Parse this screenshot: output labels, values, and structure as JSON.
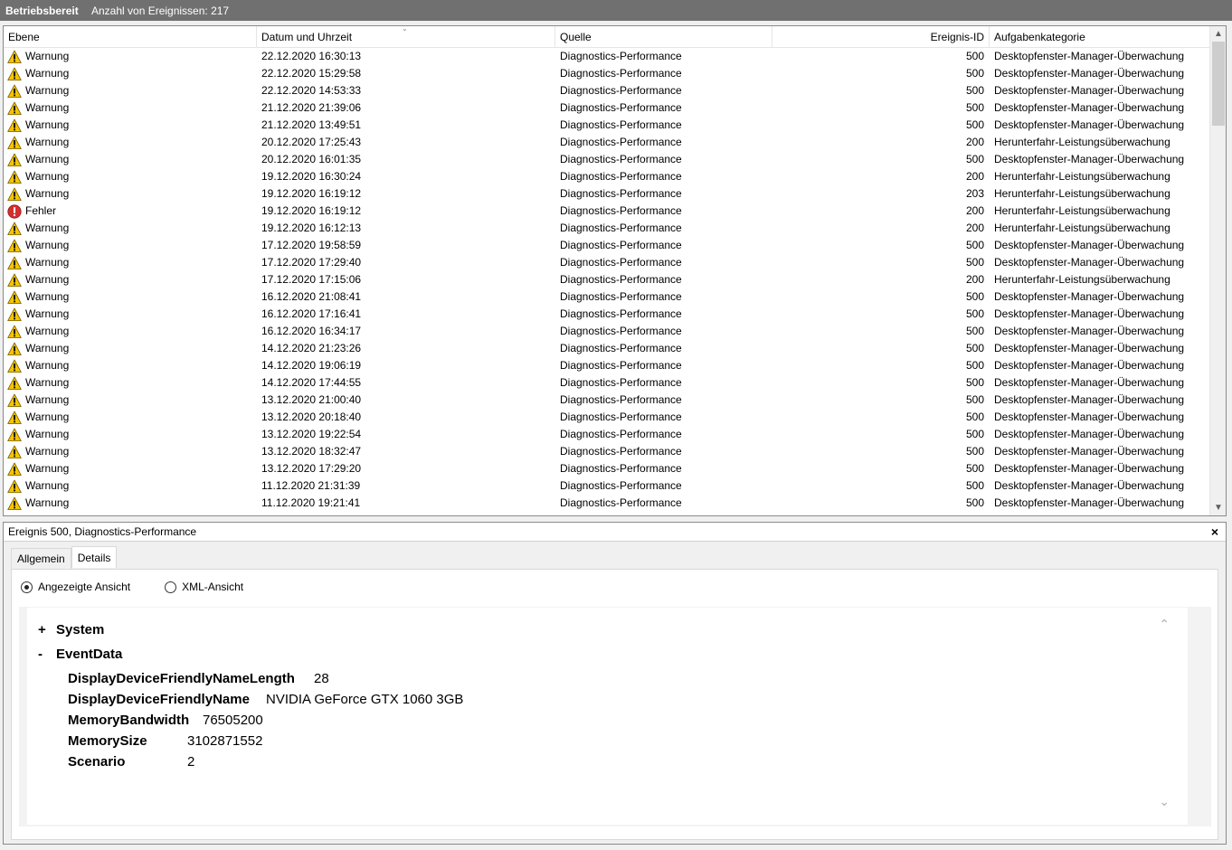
{
  "topbar": {
    "title": "Betriebsbereit",
    "count": "Anzahl von Ereignissen: 217"
  },
  "columns": {
    "level": "Ebene",
    "date": "Datum und Uhrzeit",
    "source": "Quelle",
    "id": "Ereignis-ID",
    "category": "Aufgabenkategorie"
  },
  "events": [
    {
      "level": "Warnung",
      "date": "22.12.2020 16:30:13",
      "source": "Diagnostics-Performance",
      "id": "500",
      "category": "Desktopfenster-Manager-Überwachung"
    },
    {
      "level": "Warnung",
      "date": "22.12.2020 15:29:58",
      "source": "Diagnostics-Performance",
      "id": "500",
      "category": "Desktopfenster-Manager-Überwachung"
    },
    {
      "level": "Warnung",
      "date": "22.12.2020 14:53:33",
      "source": "Diagnostics-Performance",
      "id": "500",
      "category": "Desktopfenster-Manager-Überwachung"
    },
    {
      "level": "Warnung",
      "date": "21.12.2020 21:39:06",
      "source": "Diagnostics-Performance",
      "id": "500",
      "category": "Desktopfenster-Manager-Überwachung"
    },
    {
      "level": "Warnung",
      "date": "21.12.2020 13:49:51",
      "source": "Diagnostics-Performance",
      "id": "500",
      "category": "Desktopfenster-Manager-Überwachung"
    },
    {
      "level": "Warnung",
      "date": "20.12.2020 17:25:43",
      "source": "Diagnostics-Performance",
      "id": "200",
      "category": "Herunterfahr-Leistungsüberwachung"
    },
    {
      "level": "Warnung",
      "date": "20.12.2020 16:01:35",
      "source": "Diagnostics-Performance",
      "id": "500",
      "category": "Desktopfenster-Manager-Überwachung"
    },
    {
      "level": "Warnung",
      "date": "19.12.2020 16:30:24",
      "source": "Diagnostics-Performance",
      "id": "200",
      "category": "Herunterfahr-Leistungsüberwachung"
    },
    {
      "level": "Warnung",
      "date": "19.12.2020 16:19:12",
      "source": "Diagnostics-Performance",
      "id": "203",
      "category": "Herunterfahr-Leistungsüberwachung"
    },
    {
      "level": "Fehler",
      "date": "19.12.2020 16:19:12",
      "source": "Diagnostics-Performance",
      "id": "200",
      "category": "Herunterfahr-Leistungsüberwachung"
    },
    {
      "level": "Warnung",
      "date": "19.12.2020 16:12:13",
      "source": "Diagnostics-Performance",
      "id": "200",
      "category": "Herunterfahr-Leistungsüberwachung"
    },
    {
      "level": "Warnung",
      "date": "17.12.2020 19:58:59",
      "source": "Diagnostics-Performance",
      "id": "500",
      "category": "Desktopfenster-Manager-Überwachung"
    },
    {
      "level": "Warnung",
      "date": "17.12.2020 17:29:40",
      "source": "Diagnostics-Performance",
      "id": "500",
      "category": "Desktopfenster-Manager-Überwachung"
    },
    {
      "level": "Warnung",
      "date": "17.12.2020 17:15:06",
      "source": "Diagnostics-Performance",
      "id": "200",
      "category": "Herunterfahr-Leistungsüberwachung"
    },
    {
      "level": "Warnung",
      "date": "16.12.2020 21:08:41",
      "source": "Diagnostics-Performance",
      "id": "500",
      "category": "Desktopfenster-Manager-Überwachung"
    },
    {
      "level": "Warnung",
      "date": "16.12.2020 17:16:41",
      "source": "Diagnostics-Performance",
      "id": "500",
      "category": "Desktopfenster-Manager-Überwachung"
    },
    {
      "level": "Warnung",
      "date": "16.12.2020 16:34:17",
      "source": "Diagnostics-Performance",
      "id": "500",
      "category": "Desktopfenster-Manager-Überwachung"
    },
    {
      "level": "Warnung",
      "date": "14.12.2020 21:23:26",
      "source": "Diagnostics-Performance",
      "id": "500",
      "category": "Desktopfenster-Manager-Überwachung"
    },
    {
      "level": "Warnung",
      "date": "14.12.2020 19:06:19",
      "source": "Diagnostics-Performance",
      "id": "500",
      "category": "Desktopfenster-Manager-Überwachung"
    },
    {
      "level": "Warnung",
      "date": "14.12.2020 17:44:55",
      "source": "Diagnostics-Performance",
      "id": "500",
      "category": "Desktopfenster-Manager-Überwachung"
    },
    {
      "level": "Warnung",
      "date": "13.12.2020 21:00:40",
      "source": "Diagnostics-Performance",
      "id": "500",
      "category": "Desktopfenster-Manager-Überwachung"
    },
    {
      "level": "Warnung",
      "date": "13.12.2020 20:18:40",
      "source": "Diagnostics-Performance",
      "id": "500",
      "category": "Desktopfenster-Manager-Überwachung"
    },
    {
      "level": "Warnung",
      "date": "13.12.2020 19:22:54",
      "source": "Diagnostics-Performance",
      "id": "500",
      "category": "Desktopfenster-Manager-Überwachung"
    },
    {
      "level": "Warnung",
      "date": "13.12.2020 18:32:47",
      "source": "Diagnostics-Performance",
      "id": "500",
      "category": "Desktopfenster-Manager-Überwachung"
    },
    {
      "level": "Warnung",
      "date": "13.12.2020 17:29:20",
      "source": "Diagnostics-Performance",
      "id": "500",
      "category": "Desktopfenster-Manager-Überwachung"
    },
    {
      "level": "Warnung",
      "date": "11.12.2020 21:31:39",
      "source": "Diagnostics-Performance",
      "id": "500",
      "category": "Desktopfenster-Manager-Überwachung"
    },
    {
      "level": "Warnung",
      "date": "11.12.2020 19:21:41",
      "source": "Diagnostics-Performance",
      "id": "500",
      "category": "Desktopfenster-Manager-Überwachung"
    }
  ],
  "detail": {
    "header": "Ereignis 500, Diagnostics-Performance",
    "close": "×",
    "tabs": {
      "general": "Allgemein",
      "details": "Details"
    },
    "radio_friendly": "Angezeigte Ansicht",
    "radio_xml": "XML-Ansicht",
    "system_toggle": "+",
    "system_label": "System",
    "eventdata_toggle": "-",
    "eventdata_label": "EventData",
    "fields": [
      {
        "key": "DisplayDeviceFriendlyNameLength",
        "value": "28"
      },
      {
        "key": "DisplayDeviceFriendlyName",
        "value": "NVIDIA GeForce GTX 1060 3GB"
      },
      {
        "key": "MemoryBandwidth",
        "value": "76505200"
      },
      {
        "key": "MemorySize",
        "value": "3102871552"
      },
      {
        "key": "Scenario",
        "value": "2"
      }
    ]
  },
  "icons": {
    "warning": "warning-icon",
    "error": "error-icon"
  },
  "colors": {
    "topbar": "#707070",
    "warning": "#f5c400",
    "error": "#d32f2f"
  }
}
